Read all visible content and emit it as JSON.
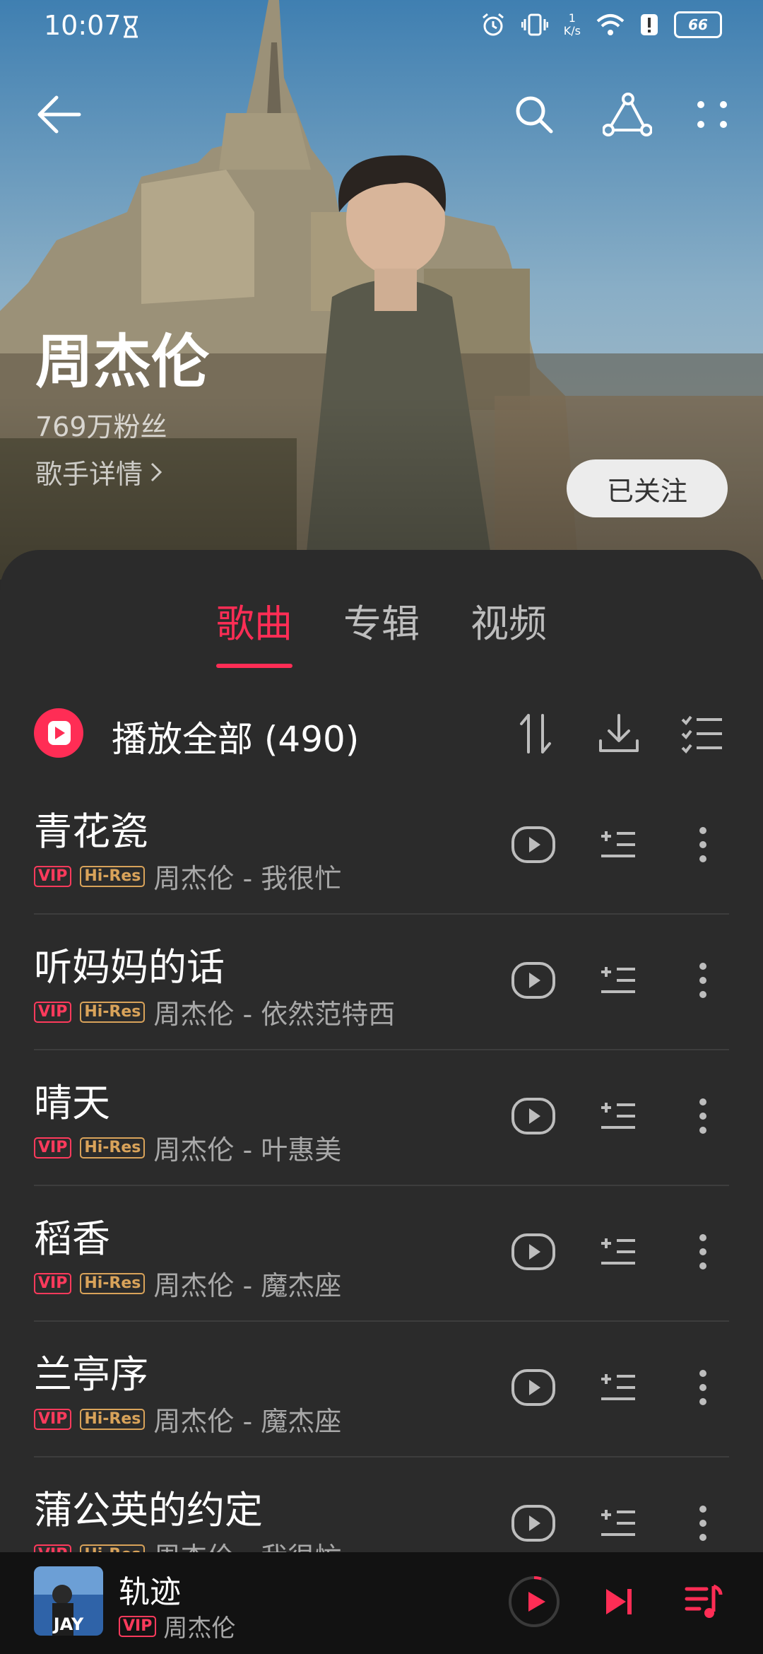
{
  "status": {
    "time": "10:07",
    "net_speed_top": "1",
    "net_speed_unit": "K/s",
    "battery": "66"
  },
  "artist": {
    "name": "周杰伦",
    "fans": "769万粉丝",
    "detail_label": "歌手详情",
    "follow_label": "已关注"
  },
  "tabs": [
    {
      "label": "歌曲",
      "active": true
    },
    {
      "label": "专辑",
      "active": false
    },
    {
      "label": "视频",
      "active": false
    }
  ],
  "play_all": {
    "label": "播放全部 (490)"
  },
  "tags": {
    "vip": "VIP",
    "hires": "Hi-Res"
  },
  "songs": [
    {
      "title": "青花瓷",
      "meta": "周杰伦 - 我很忙"
    },
    {
      "title": "听妈妈的话",
      "meta": "周杰伦 - 依然范特西"
    },
    {
      "title": "晴天",
      "meta": "周杰伦 - 叶惠美"
    },
    {
      "title": "稻香",
      "meta": "周杰伦 - 魔杰座"
    },
    {
      "title": "兰亭序",
      "meta": "周杰伦 - 魔杰座"
    },
    {
      "title": "蒲公英的约定",
      "meta": "周杰伦 - 我很忙"
    }
  ],
  "now_playing": {
    "title": "轨迹",
    "artist": "周杰伦",
    "vip": "VIP",
    "cover_text": "JAY"
  },
  "colors": {
    "accent": "#ff2d55",
    "panel": "#2b2b2b",
    "player": "#121212"
  }
}
